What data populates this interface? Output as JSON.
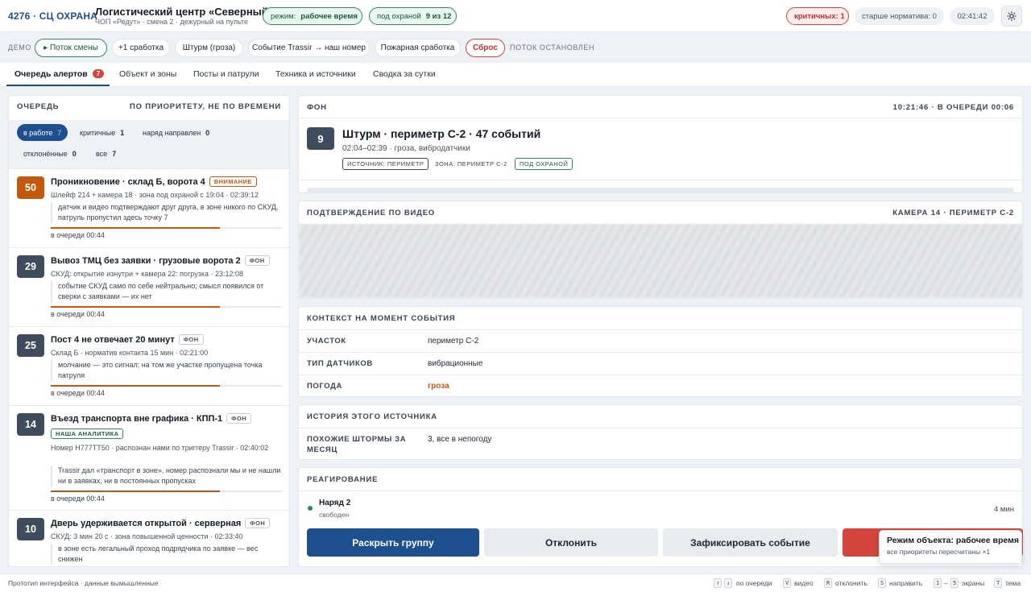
{
  "header": {
    "brand": "4276 · СЦ ОХРАНА",
    "site_title": "Логистический центр «Северный»",
    "site_sub": "ЧОП «Редут» · смена 2 · дежурный на пульте",
    "mode_label": "режим:",
    "mode_value": "рабочее время",
    "guard_label": "под охраной",
    "guard_value": "9 из 12",
    "critical": "критичных: 1",
    "overdue": "старше норматива: 0",
    "clock": "02:41:42",
    "theme_icon": "sun-icon"
  },
  "demo": {
    "label": "ДЕМО",
    "buttons": [
      "▸ Поток смены",
      "+1 сработка",
      "Штурм (гроза)",
      "Событие Trassir → наш номер",
      "Пожарная сработка",
      "Сброс"
    ],
    "status": "ПОТОК ОСТАНОВЛЕН"
  },
  "tabs": [
    {
      "label": "Очередь алертов",
      "badge": "7"
    },
    {
      "label": "Объект и зоны"
    },
    {
      "label": "Посты и патрули"
    },
    {
      "label": "Техника и источники"
    },
    {
      "label": "Сводка за сутки"
    }
  ],
  "queue": {
    "title": "ОЧЕРЕДЬ",
    "subtitle": "ПО ПРИОРИТЕТУ, НЕ ПО ВРЕМЕНИ",
    "filters": [
      {
        "label": "в работе",
        "count": "7"
      },
      {
        "label": "критичные",
        "count": "1"
      },
      {
        "label": "наряд направлен",
        "count": "0"
      },
      {
        "label": "отклонённые",
        "count": "0"
      },
      {
        "label": "все",
        "count": "7"
      }
    ],
    "items": [
      {
        "score": "50",
        "title": "Проникновение · склад Б, ворота 4",
        "tag": "ВНИМАНИЕ",
        "meta": "Шлейф 214 + камера 18 · зона под охраной с 19:04 · 02:39:12",
        "note": "датчик и видео подтверждают друг друга, в зоне никого по СКУД, патруль пропустил здесь точку 7",
        "wait": "в очереди 00:44",
        "progress": 0.73
      },
      {
        "score": "29",
        "title": "Вывоз ТМЦ без заявки · грузовые ворота 2",
        "tag": "ФОН",
        "meta": "СКУД: открытие изнутри + камера 22: погрузка · 23:12:08",
        "note": "событие СКУД само по себе нейтрально; смысл появился от сверки с заявками — их нет",
        "wait": "в очереди 00:44",
        "progress": 0.73
      },
      {
        "score": "25",
        "title": "Пост 4 не отвечает 20 минут",
        "tag": "ФОН",
        "meta": "Склад Б · норматив контакта 15 мин · 02:21:00",
        "note": "молчание — это сигнал; на том же участке пропущена точка патруля",
        "wait": "в очереди 00:44",
        "progress": 0.73
      },
      {
        "score": "14",
        "title": "Въезд транспорта вне графика · КПП-1",
        "tag": "ФОН",
        "tag2": "НАША АНАЛИТИКА",
        "meta": "Номер Н777ТТ50 · распознан нами по триггеру Trassir · 02:40:02",
        "note": "Trassir дал «транспорт в зоне», номер распознали мы и не нашли ни в заявках, ни в постоянных пропусках",
        "wait": "в очереди 00:44",
        "progress": 0.73
      },
      {
        "score": "10",
        "title": "Дверь удерживается открытой · серверная",
        "tag": "ФОН",
        "meta": "СКУД: 3 мин 20 с · зона повышенной ценности · 02:33:40",
        "note": "в зоне есть легальный проход подрядчика по заявке — вес снижен"
      }
    ]
  },
  "event": {
    "section": "ФОН",
    "time": "10:21:46 · В ОЧЕРЕДИ 00:06",
    "score": "9",
    "title": "Штурм · периметр С-2 · 47 событий",
    "sub": "02:04–02:39 · гроза, вибродатчики",
    "tags": [
      "ИСТОЧНИК: ПЕРИМЕТР",
      "ЗОНА: ПЕРИМЕТР С-2",
      "ПОД ОХРАНОЙ"
    ]
  },
  "video": {
    "title": "ПОДТВЕРЖДЕНИЕ ПО ВИДЕО",
    "camera": "КАМЕРА 14 · ПЕРИМЕТР С-2"
  },
  "context": {
    "title": "КОНТЕКСТ НА МОМЕНТ СОБЫТИЯ",
    "rows": [
      {
        "label": "УЧАСТОК",
        "value": "периметр С-2"
      },
      {
        "label": "ТИП ДАТЧИКОВ",
        "value": "вибрационные"
      },
      {
        "label": "ПОГОДА",
        "value": "гроза"
      }
    ]
  },
  "history": {
    "title": "ИСТОРИЯ ЭТОГО ИСТОЧНИКА",
    "label": "ПОХОЖИЕ ШТОРМЫ ЗА МЕСЯЦ",
    "value": "3, все в непогоду"
  },
  "response": {
    "title": "РЕАГИРОВАНИЕ",
    "unit": "Наряд 2",
    "unit_status": "свободен",
    "unit_time": "4 мин"
  },
  "actions": {
    "expand": "Раскрыть группу",
    "reject": "Отклонить",
    "record": "Зафиксировать событие"
  },
  "toast": {
    "title": "Режим объекта: рабочее время",
    "sub": "все приоритеты пересчитаны ×1"
  },
  "footer": {
    "left": "Прототип интерфейса · данные вымышленные",
    "hints": [
      {
        "keys": [
          "↑",
          "↓"
        ],
        "text": "по очереди"
      },
      {
        "keys": [
          "V"
        ],
        "text": "видео"
      },
      {
        "keys": [
          "R"
        ],
        "text": "отклонить"
      },
      {
        "keys": [
          "S"
        ],
        "text": "направить"
      },
      {
        "keys": [
          "1",
          "5"
        ],
        "text": "экраны"
      },
      {
        "keys": [
          "T"
        ],
        "text": "тема"
      }
    ]
  },
  "colors": {
    "accent": "#1e4f8f",
    "critical": "#d6453d",
    "warning": "#c2590e",
    "ok": "#2f8a5e"
  }
}
